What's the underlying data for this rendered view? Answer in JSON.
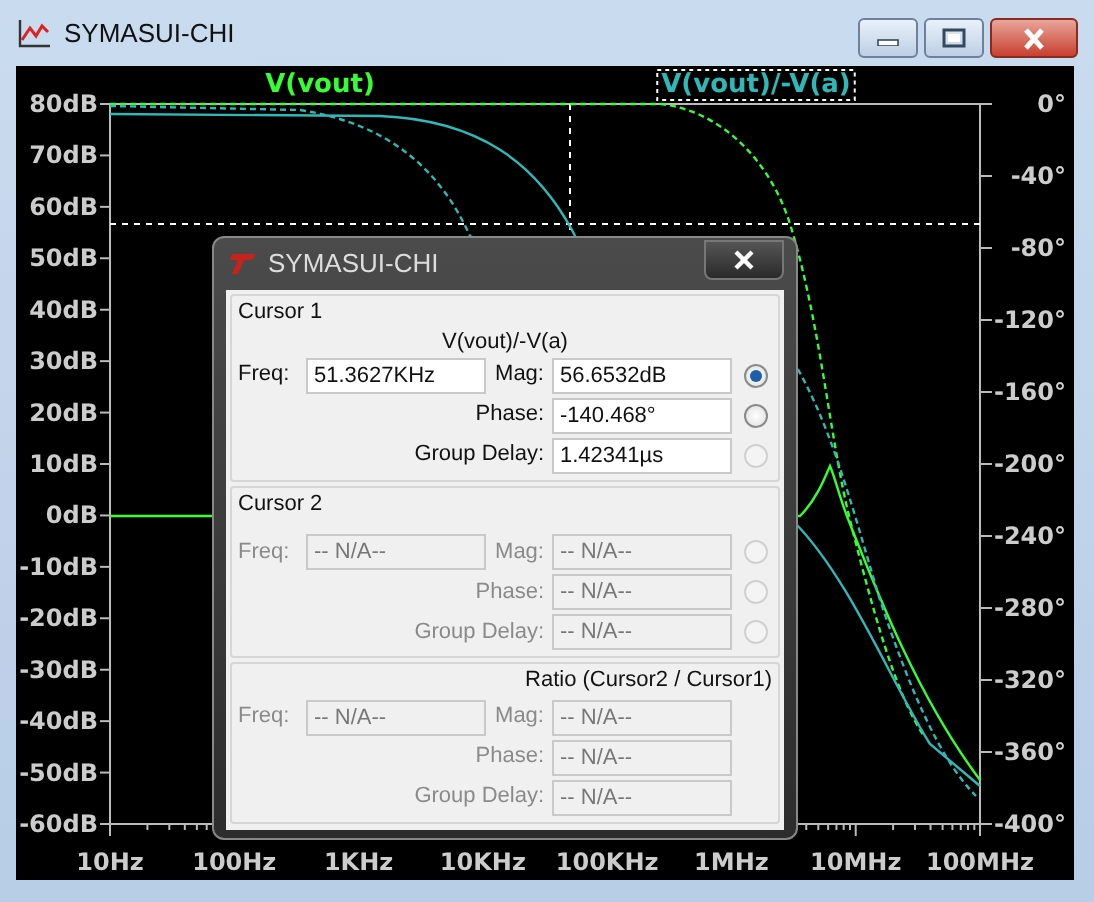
{
  "window": {
    "title": "SYMASUI-CHI"
  },
  "plot": {
    "traces": [
      {
        "label": "V(vout)",
        "color": "#33ff33",
        "selected": false
      },
      {
        "label": "V(vout)/-V(a)",
        "color": "#2fb8b8",
        "selected": true
      }
    ],
    "left_axis": [
      "80dB",
      "70dB",
      "60dB",
      "50dB",
      "40dB",
      "30dB",
      "20dB",
      "10dB",
      "0dB",
      "-10dB",
      "-20dB",
      "-30dB",
      "-40dB",
      "-50dB",
      "-60dB"
    ],
    "right_axis": [
      "0°",
      "-40°",
      "-80°",
      "-120°",
      "-160°",
      "-200°",
      "-240°",
      "-280°",
      "-320°",
      "-360°",
      "-400°"
    ],
    "bottom_axis": [
      "10Hz",
      "100Hz",
      "1KHz",
      "10KHz",
      "100KHz",
      "1MHz",
      "10MHz",
      "100MHz"
    ]
  },
  "dialog": {
    "title": "SYMASUI-CHI",
    "sections": [
      {
        "kind": "cursor",
        "heading": "Cursor 1",
        "trace": "V(vout)/-V(a)",
        "freq": {
          "label": "Freq:",
          "value": "51.3627KHz",
          "disabled": false
        },
        "rows": [
          {
            "label": "Mag:",
            "value": "56.6532dB",
            "disabled": false,
            "radio": {
              "selected": true,
              "disabled": false
            }
          },
          {
            "label": "Phase:",
            "value": "-140.468°",
            "disabled": false,
            "radio": {
              "selected": false,
              "disabled": false
            }
          },
          {
            "label": "Group Delay:",
            "value": "1.42341µs",
            "disabled": false,
            "radio": {
              "selected": false,
              "disabled": true
            }
          }
        ]
      },
      {
        "kind": "cursor",
        "heading": "Cursor 2",
        "freq": {
          "label": "Freq:",
          "value": "-- N/A--",
          "disabled": true
        },
        "rows": [
          {
            "label": "Mag:",
            "value": "-- N/A--",
            "disabled": true,
            "radio": {
              "selected": false,
              "disabled": true
            }
          },
          {
            "label": "Phase:",
            "value": "-- N/A--",
            "disabled": true,
            "radio": {
              "selected": false,
              "disabled": true
            }
          },
          {
            "label": "Group Delay:",
            "value": "-- N/A--",
            "disabled": true,
            "radio": {
              "selected": false,
              "disabled": true
            }
          }
        ]
      },
      {
        "kind": "ratio",
        "heading": "Ratio (Cursor2 / Cursor1)",
        "freq": {
          "label": "Freq:",
          "value": "-- N/A--",
          "disabled": true
        },
        "rows": [
          {
            "label": "Mag:",
            "value": "-- N/A--",
            "disabled": true
          },
          {
            "label": "Phase:",
            "value": "-- N/A--",
            "disabled": true
          },
          {
            "label": "Group Delay:",
            "value": "-- N/A--",
            "disabled": true
          }
        ]
      }
    ]
  }
}
